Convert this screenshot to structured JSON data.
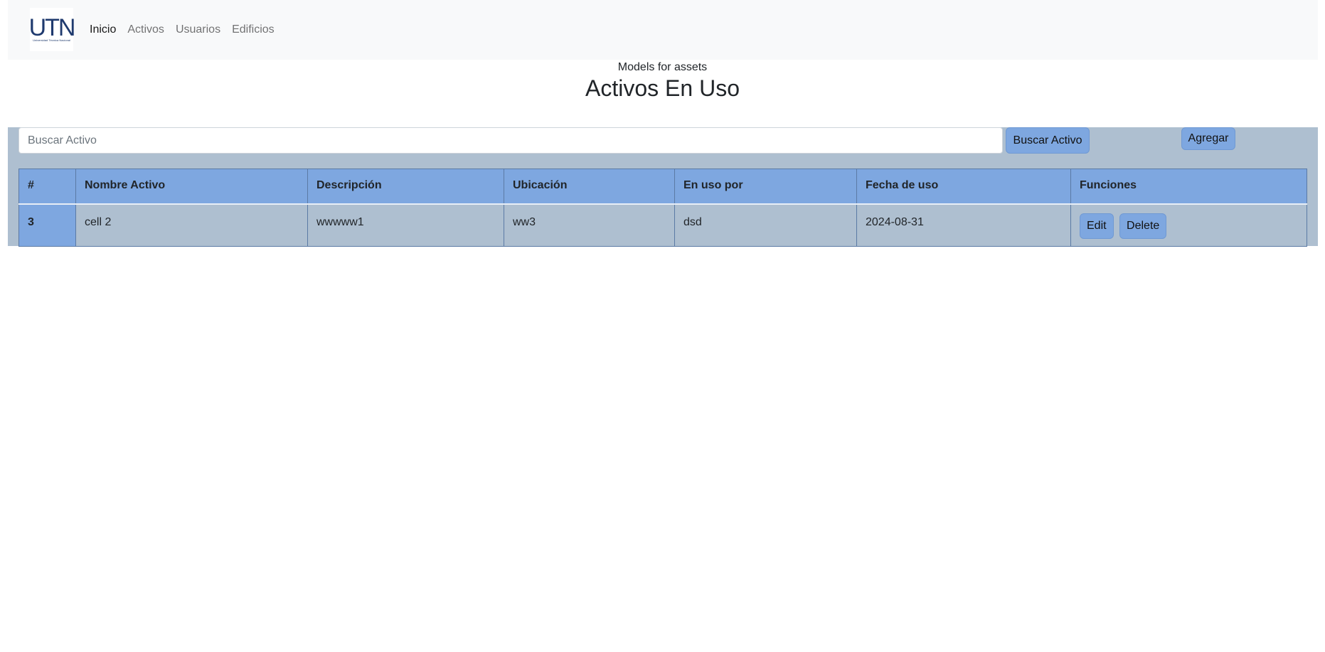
{
  "navbar": {
    "logo_text": "UTN",
    "logo_subtext": "Universidad Técnica Nacional",
    "links": [
      {
        "label": "Inicio",
        "active": true
      },
      {
        "label": "Activos",
        "active": false
      },
      {
        "label": "Usuarios",
        "active": false
      },
      {
        "label": "Edificios",
        "active": false
      }
    ]
  },
  "header": {
    "subtitle": "Models for assets",
    "title": "Activos En Uso"
  },
  "search": {
    "placeholder": "Buscar Activo",
    "value": "",
    "button_label": "Buscar Activo"
  },
  "add_button_label": "Agregar",
  "table": {
    "columns": [
      "#",
      "Nombre Activo",
      "Descripción",
      "Ubicación",
      "En uso por",
      "Fecha de uso",
      "Funciones"
    ],
    "rows": [
      {
        "id": "3",
        "nombre": "cell 2",
        "descripcion": "wwwww1",
        "ubicacion": "ww3",
        "en_uso_por": "dsd",
        "fecha": "2024-08-31",
        "edit_label": "Edit",
        "delete_label": "Delete"
      }
    ]
  },
  "colors": {
    "navbar_bg": "#f8f9fa",
    "panel_bg": "#aebfd0",
    "accent_blue": "#7ea7e0",
    "logo_blue": "#1f3a6e"
  }
}
